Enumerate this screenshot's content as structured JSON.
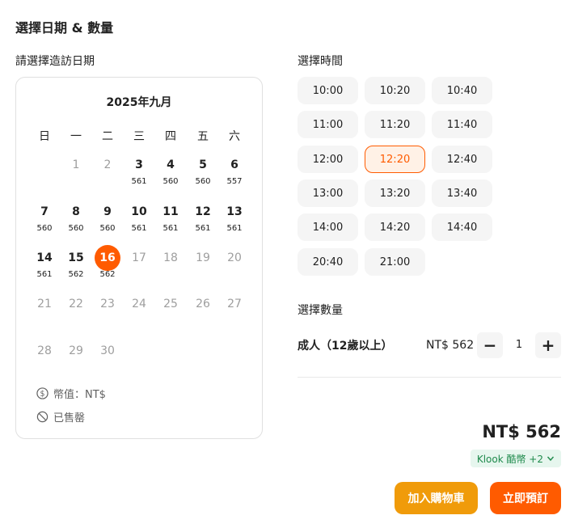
{
  "page": {
    "title": "選擇日期 & 數量"
  },
  "date_section": {
    "label": "請選擇造訪日期"
  },
  "time_section": {
    "label": "選擇時間"
  },
  "quantity_section": {
    "label": "選擇數量"
  },
  "calendar": {
    "month": "2025年九月",
    "weekdays": [
      "日",
      "一",
      "二",
      "三",
      "四",
      "五",
      "六"
    ],
    "days": [
      {
        "num": "1",
        "state": "disabled",
        "price": ""
      },
      {
        "num": "2",
        "state": "disabled",
        "price": ""
      },
      {
        "num": "3",
        "state": "avail",
        "price": "561"
      },
      {
        "num": "4",
        "state": "avail",
        "price": "560"
      },
      {
        "num": "5",
        "state": "avail",
        "price": "560"
      },
      {
        "num": "6",
        "state": "avail",
        "price": "557"
      },
      {
        "num": "7",
        "state": "avail",
        "price": "560"
      },
      {
        "num": "8",
        "state": "avail",
        "price": "560"
      },
      {
        "num": "9",
        "state": "avail",
        "price": "560"
      },
      {
        "num": "10",
        "state": "avail",
        "price": "561"
      },
      {
        "num": "11",
        "state": "avail",
        "price": "561"
      },
      {
        "num": "12",
        "state": "avail",
        "price": "561"
      },
      {
        "num": "13",
        "state": "avail",
        "price": "561"
      },
      {
        "num": "14",
        "state": "avail",
        "price": "561"
      },
      {
        "num": "15",
        "state": "avail",
        "price": "562"
      },
      {
        "num": "16",
        "state": "selected",
        "price": "562"
      },
      {
        "num": "17",
        "state": "disabled",
        "price": ""
      },
      {
        "num": "18",
        "state": "disabled",
        "price": ""
      },
      {
        "num": "19",
        "state": "disabled",
        "price": ""
      },
      {
        "num": "20",
        "state": "disabled",
        "price": ""
      },
      {
        "num": "21",
        "state": "disabled",
        "price": ""
      },
      {
        "num": "22",
        "state": "disabled",
        "price": ""
      },
      {
        "num": "23",
        "state": "disabled",
        "price": ""
      },
      {
        "num": "24",
        "state": "disabled",
        "price": ""
      },
      {
        "num": "25",
        "state": "disabled",
        "price": ""
      },
      {
        "num": "26",
        "state": "disabled",
        "price": ""
      },
      {
        "num": "27",
        "state": "disabled",
        "price": ""
      },
      {
        "num": "28",
        "state": "disabled",
        "price": ""
      },
      {
        "num": "29",
        "state": "disabled",
        "price": ""
      },
      {
        "num": "30",
        "state": "disabled",
        "price": ""
      }
    ],
    "legend": {
      "currency": "幣值：NT$",
      "currency_icon": "dollar-icon",
      "sold_out": "已售罄",
      "sold_out_icon": "prohibited-icon"
    }
  },
  "time_slots": [
    {
      "label": "10:00",
      "selected": false
    },
    {
      "label": "10:20",
      "selected": false
    },
    {
      "label": "10:40",
      "selected": false
    },
    {
      "label": "11:00",
      "selected": false
    },
    {
      "label": "11:20",
      "selected": false
    },
    {
      "label": "11:40",
      "selected": false
    },
    {
      "label": "12:00",
      "selected": false
    },
    {
      "label": "12:20",
      "selected": true
    },
    {
      "label": "12:40",
      "selected": false
    },
    {
      "label": "13:00",
      "selected": false
    },
    {
      "label": "13:20",
      "selected": false
    },
    {
      "label": "13:40",
      "selected": false
    },
    {
      "label": "14:00",
      "selected": false
    },
    {
      "label": "14:20",
      "selected": false
    },
    {
      "label": "14:40",
      "selected": false
    },
    {
      "label": "20:40",
      "selected": false
    },
    {
      "label": "21:00",
      "selected": false
    }
  ],
  "quantity": {
    "item_label": "成人（12歲以上）",
    "unit_price": "NT$ 562",
    "minus": "−",
    "plus": "+",
    "value": "1"
  },
  "summary": {
    "total": "NT$ 562",
    "klook_coins": "Klook 酷幣 +2",
    "chevron_icon": "chevron-down-icon"
  },
  "actions": {
    "add_to_cart": "加入購物車",
    "book_now": "立即預訂"
  },
  "colors": {
    "accent": "#ff5b00",
    "cart_button": "#f09b0a",
    "coin_green": "#1f8a4c"
  }
}
